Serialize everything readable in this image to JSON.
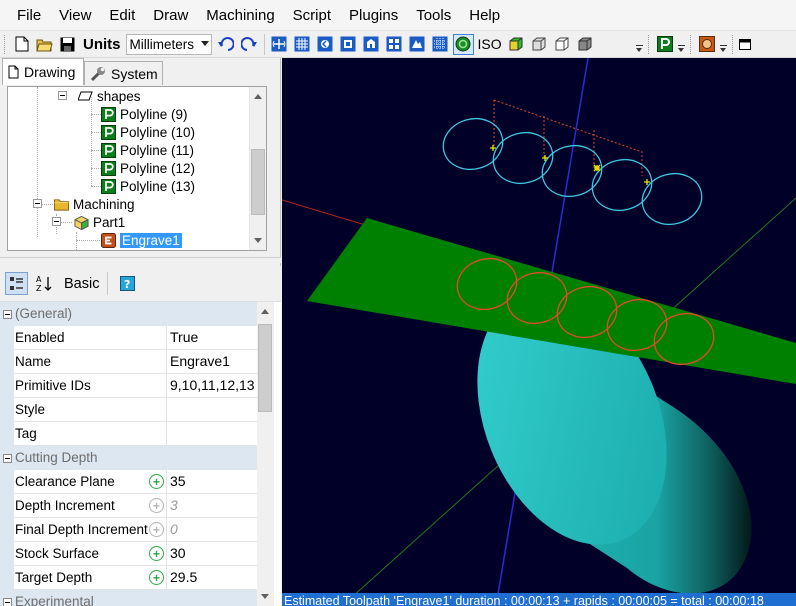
{
  "menu": [
    "File",
    "View",
    "Edit",
    "Draw",
    "Machining",
    "Script",
    "Plugins",
    "Tools",
    "Help"
  ],
  "toolbar": {
    "units_label": "Units",
    "units_value": "Millimeters",
    "iso_label": "ISO"
  },
  "tabs": {
    "drawing": "Drawing",
    "system": "System"
  },
  "tree": {
    "shapes_label": "shapes",
    "polylines": [
      "Polyline (9)",
      "Polyline (10)",
      "Polyline (11)",
      "Polyline (12)",
      "Polyline (13)"
    ],
    "machining_label": "Machining",
    "part_label": "Part1",
    "op_label": "Engrave1"
  },
  "propgrid": {
    "basic_label": "Basic",
    "categories": {
      "general": "(General)",
      "cutting_depth": "Cutting Depth",
      "experimental": "Experimental"
    },
    "general": [
      {
        "name": "Enabled",
        "value": "True"
      },
      {
        "name": "Name",
        "value": "Engrave1"
      },
      {
        "name": "Primitive IDs",
        "value": "9,10,11,12,13"
      },
      {
        "name": "Style",
        "value": ""
      },
      {
        "name": "Tag",
        "value": ""
      }
    ],
    "cutting": [
      {
        "name": "Clearance Plane",
        "value": "35"
      },
      {
        "name": "Depth Increment",
        "value": "3"
      },
      {
        "name": "Final Depth Increment",
        "value": "0"
      },
      {
        "name": "Stock Surface",
        "value": "30"
      },
      {
        "name": "Target Depth",
        "value": "29.5"
      }
    ]
  },
  "status": "Estimated Toolpath 'Engrave1' duration : 00:00:13 + rapids : 00:00:05 = total : 00:00:18",
  "colors": {
    "viewport_bg": "#000028",
    "stock_plane": "#008000",
    "cylinder": "#1fb5b5",
    "toolpath": "#e34a2a",
    "shapes": "#3fc6e0",
    "selection": "#3399ff"
  },
  "icons": [
    "new-file-icon",
    "open-folder-icon",
    "save-icon",
    "undo-icon",
    "redo-icon",
    "view-fit-icon",
    "grid-icon",
    "view-front-icon",
    "view-top-icon",
    "view-back-icon",
    "view-left-icon",
    "view-right-icon",
    "view-bottom-icon",
    "perspective-icon",
    "shaded-cube-icon",
    "wireframe-cube-icon",
    "outline-cube-icon",
    "solid-cube-icon",
    "polyline-icon",
    "record-icon",
    "maximize-icon"
  ]
}
